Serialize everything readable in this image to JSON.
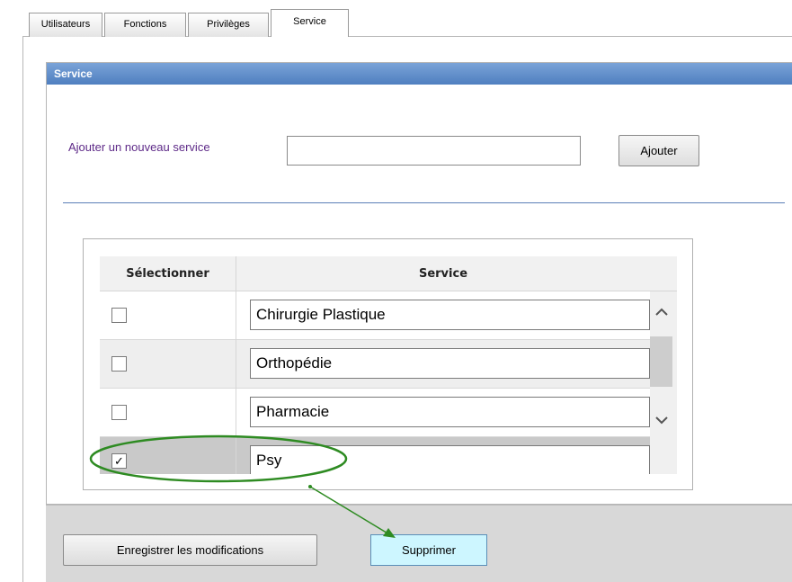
{
  "tabs": [
    {
      "label": "Utilisateurs"
    },
    {
      "label": "Fonctions"
    },
    {
      "label": "Privilèges"
    },
    {
      "label": "Service",
      "active": true
    }
  ],
  "panel": {
    "title": "Service",
    "add_label": "Ajouter un nouveau service",
    "add_input_value": "",
    "add_button": "Ajouter"
  },
  "table": {
    "headers": {
      "select": "Sélectionner",
      "service": "Service"
    },
    "rows": [
      {
        "name": "Chirurgie Plastique",
        "checked": false
      },
      {
        "name": "Orthopédie",
        "checked": false
      },
      {
        "name": "Pharmacie",
        "checked": false
      },
      {
        "name": "Psy",
        "checked": true
      }
    ]
  },
  "actions": {
    "save": "Enregistrer les modifications",
    "delete": "Supprimer"
  },
  "icons": {
    "check": "✓",
    "scroll_up": "︿",
    "scroll_down": "﹀"
  },
  "colors": {
    "header_blue": "#5a88c6",
    "annotation_green": "#2e8b22",
    "delete_highlight": "#cdf6ff",
    "label_purple": "#5e2a88"
  }
}
